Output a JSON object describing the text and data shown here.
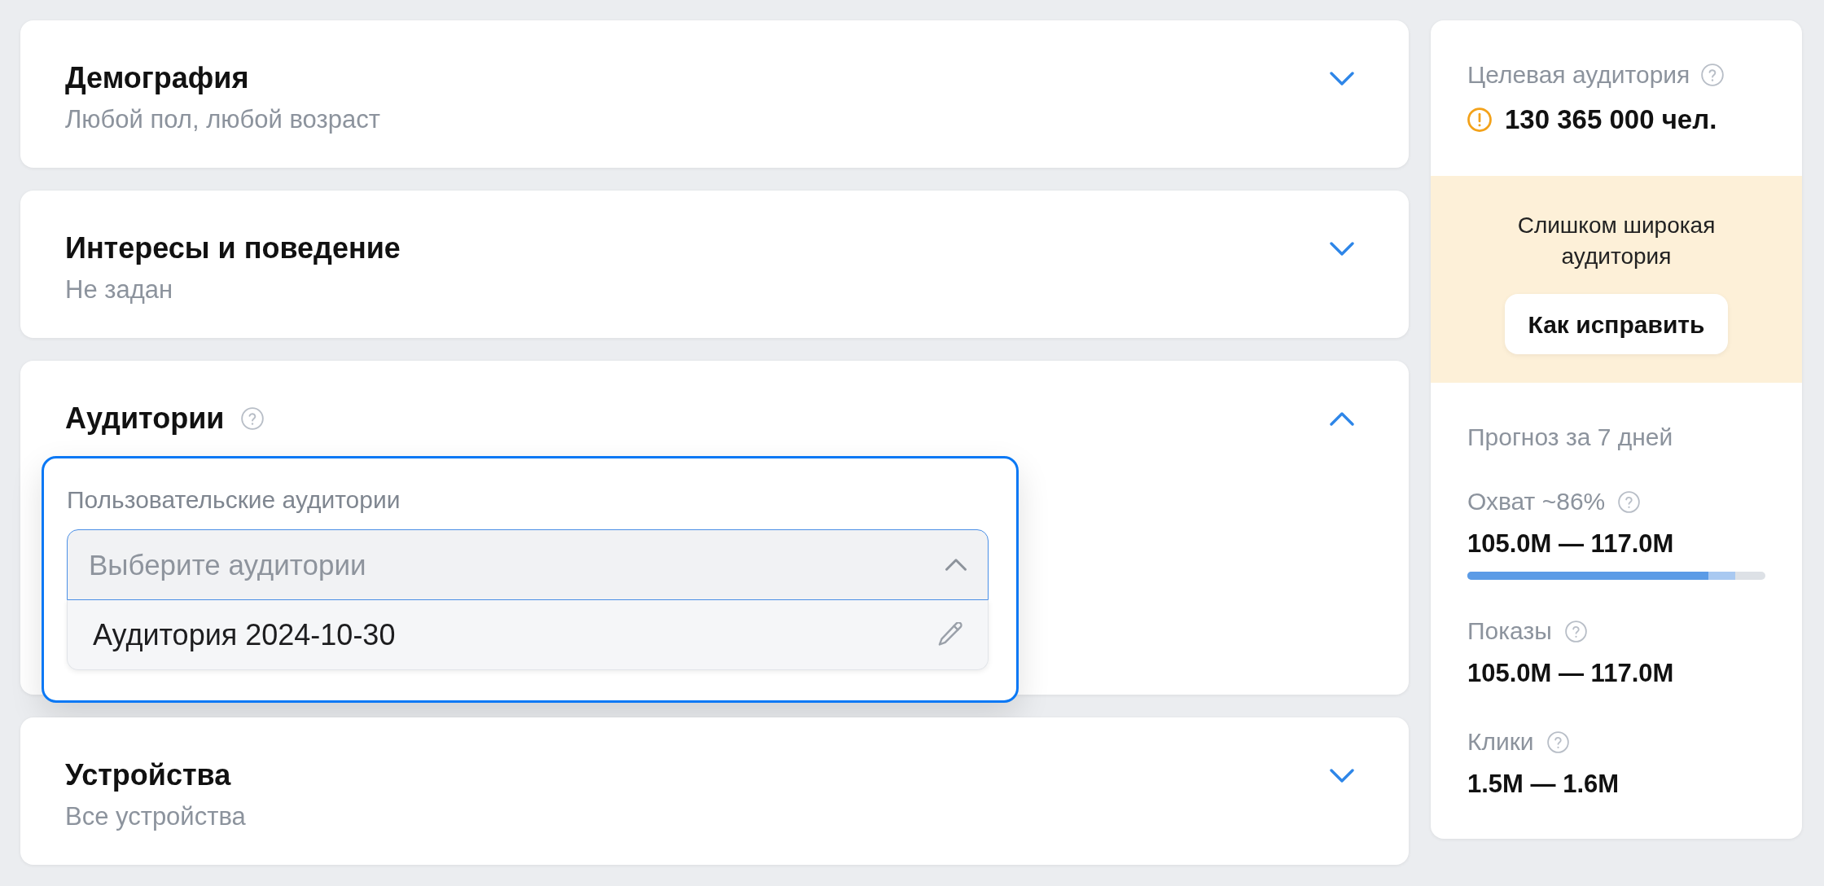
{
  "sections": [
    {
      "title": "Демография",
      "subtitle": "Любой пол, любой возраст",
      "expanded": false
    },
    {
      "title": "Интересы и поведение",
      "subtitle": "Не задан",
      "expanded": false
    },
    {
      "title": "Аудитории",
      "help": true,
      "expanded": true,
      "picker": {
        "label": "Пользовательские аудитории",
        "placeholder": "Выберите аудитории",
        "expanded": true,
        "options": [
          {
            "label": "Аудитория 2024-10-30",
            "selected": false
          }
        ]
      }
    },
    {
      "title": "Устройства",
      "subtitle": "Все устройства",
      "expanded": false
    }
  ],
  "summary": {
    "title": "Целевая аудитория",
    "help": true,
    "value": "130 365 000 чел.",
    "warning": true,
    "alert": {
      "message": "Слишком широкая аудитория",
      "button": "Как исправить"
    },
    "forecast": {
      "title": "Прогноз за 7 дней",
      "metrics": [
        {
          "kind": "meter",
          "label": "Охват ~86%",
          "help": true,
          "value": "105.0M — 117.0M",
          "fills": [
            {
              "level": 0.81,
              "color": "#5b9be6"
            },
            {
              "level": 0.9,
              "color": "#a9c9f1"
            }
          ]
        },
        {
          "kind": "plain",
          "label": "Показы",
          "help": true,
          "value": "105.0M — 117.0M"
        },
        {
          "kind": "plain",
          "label": "Клики",
          "help": true,
          "value": "1.5M — 1.6M"
        }
      ]
    }
  }
}
